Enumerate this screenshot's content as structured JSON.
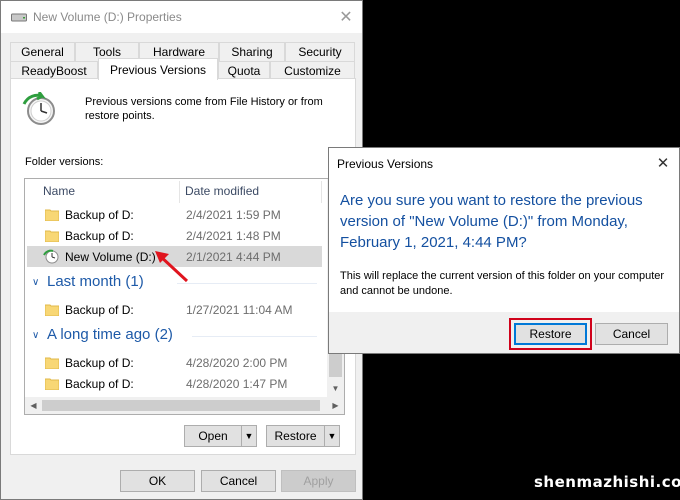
{
  "window": {
    "title": "New Volume (D:) Properties",
    "close_glyph": "✕"
  },
  "tabs": {
    "row1": [
      "General",
      "Tools",
      "Hardware",
      "Sharing",
      "Security"
    ],
    "row2": [
      "ReadyBoost",
      "Previous Versions",
      "Quota",
      "Customize"
    ],
    "active": "Previous Versions"
  },
  "panel": {
    "description": "Previous versions come from File History or from restore points.",
    "folder_versions_label": "Folder versions:",
    "columns": {
      "name": "Name",
      "date": "Date modified"
    },
    "rows": [
      {
        "name": "Backup of D:",
        "date": "2/4/2021 1:59 PM"
      },
      {
        "name": "Backup of D:",
        "date": "2/4/2021 1:48 PM"
      },
      {
        "name": "New Volume (D:)",
        "date": "2/1/2021 4:44 PM"
      },
      {
        "name": "Backup of D:",
        "date": "1/27/2021 11:04 AM"
      },
      {
        "name": "Backup of D:",
        "date": "4/28/2020 2:00 PM"
      },
      {
        "name": "Backup of D:",
        "date": "4/28/2020 1:47 PM"
      }
    ],
    "groups": [
      "Last month (1)",
      "A long time ago (2)"
    ],
    "open_button": "Open",
    "restore_button": "Restore"
  },
  "footer": {
    "ok": "OK",
    "cancel": "Cancel",
    "apply": "Apply"
  },
  "dialog": {
    "title": "Previous Versions",
    "question": "Are you sure you want to restore the previous version of \"New Volume (D:)\" from Monday, February 1, 2021, 4:44 PM?",
    "message": "This will replace the current version of this folder on your computer and cannot be undone.",
    "restore_button": "Restore",
    "cancel_button": "Cancel",
    "close_glyph": "✕"
  },
  "watermark": "shenmazhishi.com",
  "colors": {
    "accent": "#0078d7",
    "group_heading": "#1e5aa8",
    "highlight": "#d0021b",
    "selected_row": "#d9d9d9"
  },
  "icons": [
    "drive-icon",
    "restore-clock-icon",
    "folder-icon",
    "restore-version-icon",
    "dropdown-arrow-icon",
    "close-icon",
    "red-pointer-arrow"
  ]
}
